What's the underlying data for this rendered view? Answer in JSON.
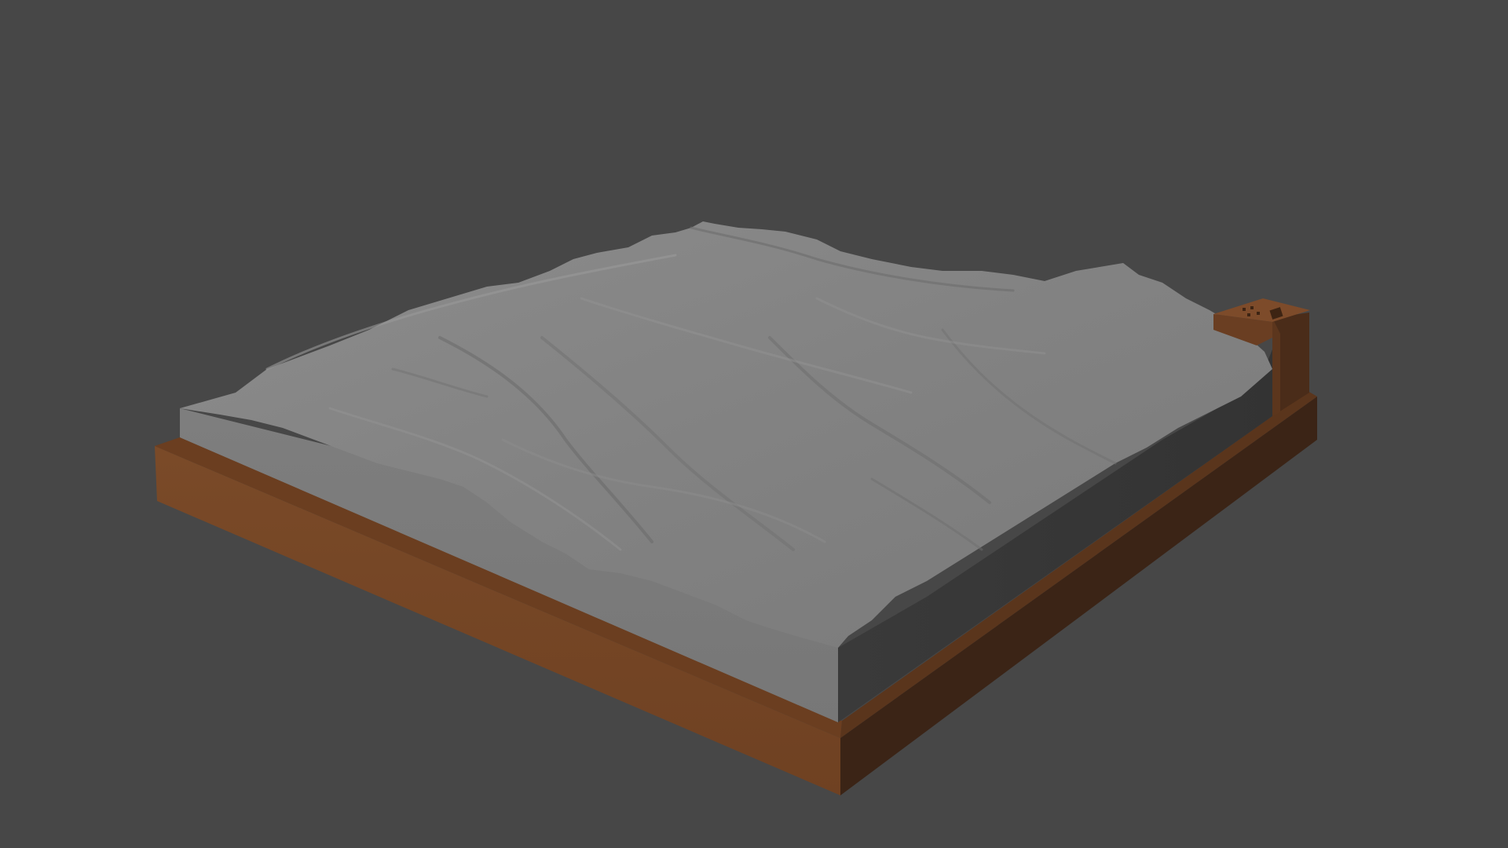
{
  "scene": {
    "background_color": "#474747",
    "object": "terrain-relief-model",
    "terrain_color": "#808080",
    "terrain_side_color": "#3a3a3a",
    "base_frame_color": "#764626",
    "base_frame_shadow_color": "#3a2417",
    "label_block_color": "#7a4a2a"
  }
}
